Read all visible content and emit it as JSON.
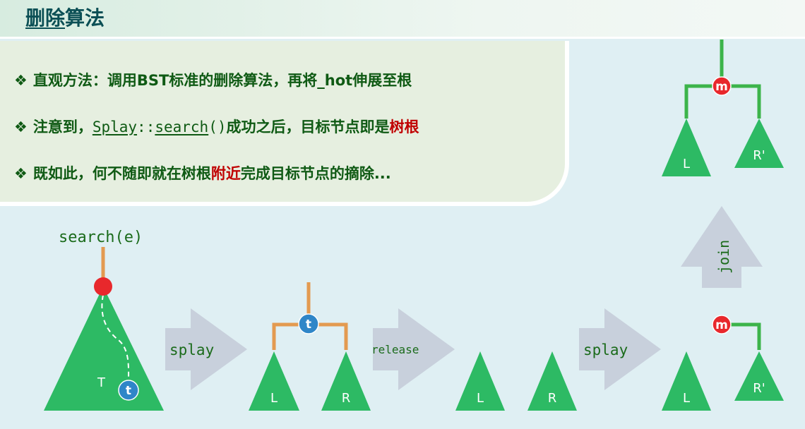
{
  "header": {
    "title_underlined": "删除",
    "title_rest": "算法"
  },
  "notes": {
    "bullet": "❖",
    "item1": "直观方法：调用BST标准的删除算法，再将_hot伸展至根",
    "item2": {
      "prefix": "注意到，",
      "code_class": "Splay",
      "code_sep": "::",
      "code_method": "search",
      "code_suffix": "()",
      "middle": "成功之后，目标节点即是",
      "highlight": "树根"
    },
    "item3": {
      "prefix": "既如此，何不随即就在树根",
      "highlight": "附近",
      "suffix": "完成目标节点的摘除..."
    }
  },
  "diagram": {
    "search_label": "search(e)",
    "tree_label": "T",
    "target_node": "t",
    "op_splay_1": "splay",
    "op_release": "release",
    "op_splay_2": "splay",
    "op_join": "join",
    "left_subtree": "L",
    "right_subtree": "R",
    "right_subtree_prime": "R'",
    "min_node": "m",
    "colors": {
      "subtree_green": "#2dba64",
      "edge_orange": "#e39a50",
      "edge_green": "#3cb44a",
      "node_red": "#e8282c",
      "node_blue": "#2f86c8",
      "arrow_gray": "#c8d0dc"
    }
  }
}
